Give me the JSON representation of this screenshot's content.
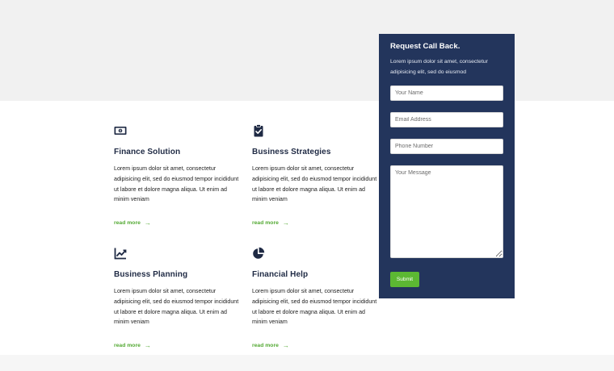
{
  "services": [
    {
      "icon": "money-bill-icon",
      "title": "Finance Solution",
      "description": "Lorem ipsum dolor sit amet, consectetur adipisicing elit, sed do eiusmod tempor incididunt ut labore et dolore magna aliqua. Ut enim ad minim veniam",
      "link": "read more"
    },
    {
      "icon": "clipboard-check-icon",
      "title": "Business Strategies",
      "description": "Lorem ipsum dolor sit amet, consectetur adipisicing elit, sed do eiusmod tempor incididunt ut labore et dolore magna aliqua. Ut enim ad minim veniam",
      "link": "read more"
    },
    {
      "icon": "chart-line-icon",
      "title": "Business Planning",
      "description": "Lorem ipsum dolor sit amet, consectetur adipisicing elit, sed do eiusmod tempor incididunt ut labore et dolore magna aliqua. Ut enim ad minim veniam",
      "link": "read more"
    },
    {
      "icon": "pie-chart-icon",
      "title": "Financial Help",
      "description": "Lorem ipsum dolor sit amet, consectetur adipisicing elit, sed do eiusmod tempor incididunt ut labore et dolore magna aliqua. Ut enim ad minim veniam",
      "link": "read more"
    }
  ],
  "callback": {
    "title": "Request Call Back.",
    "text": "Lorem ipsum dolor sit amet, consectetur adipisicing elit, sed do eiusmod",
    "name_placeholder": "Your Name",
    "email_placeholder": "Email Address",
    "phone_placeholder": "Phone Number",
    "message_placeholder": "Your Message",
    "submit_label": "Submit"
  },
  "colors": {
    "panel": "#23355c",
    "accent": "#5cb833",
    "heading": "#1f2a44"
  }
}
